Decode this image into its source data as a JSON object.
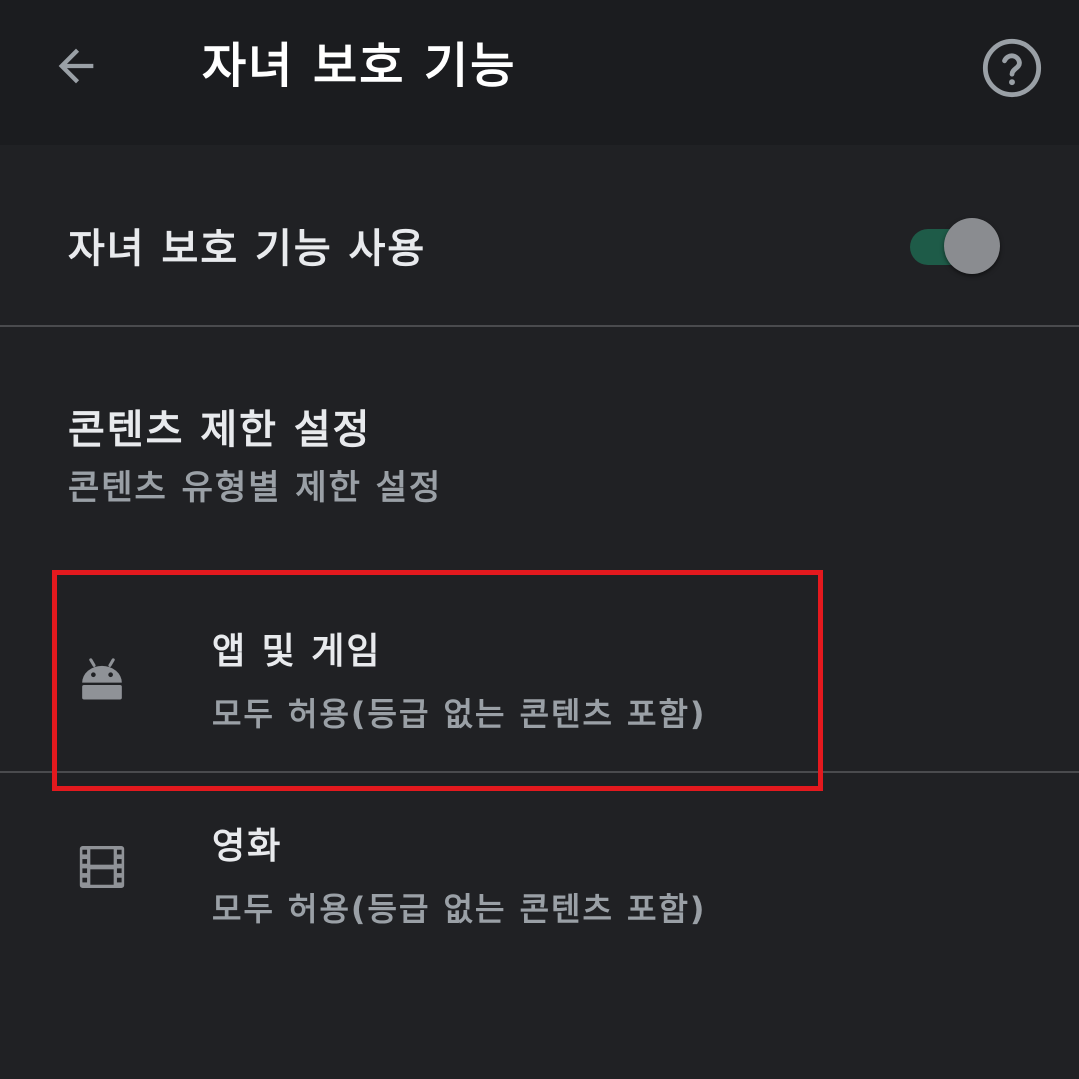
{
  "appbar": {
    "title": "자녀 보호 기능",
    "back_icon": "arrow-back-icon",
    "help_icon": "help-circle-icon"
  },
  "parental_toggle": {
    "label": "자녀 보호 기능 사용",
    "enabled": true,
    "track_color": "#1e5b48",
    "thumb_color": "#8a8c90"
  },
  "content_section": {
    "title": "콘텐츠 제한 설정",
    "subtitle": "콘텐츠 유형별 제한 설정"
  },
  "items": [
    {
      "icon": "android-icon",
      "title": "앱 및 게임",
      "subtitle": "모두 허용(등급 없는 콘텐츠 포함)"
    },
    {
      "icon": "film-icon",
      "title": "영화",
      "subtitle": "모두 허용(등급 없는 콘텐츠 포함)"
    }
  ],
  "colors": {
    "background": "#202124",
    "appbar": "#1b1c1f",
    "highlight": "#e3191e"
  }
}
